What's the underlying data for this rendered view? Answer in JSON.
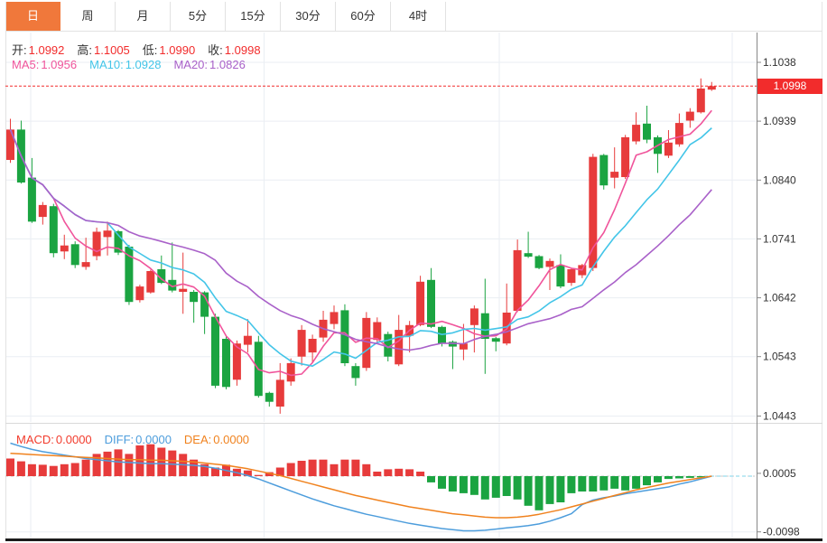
{
  "tabs": {
    "items": [
      {
        "label": "日",
        "active": true
      },
      {
        "label": "周",
        "active": false
      },
      {
        "label": "月",
        "active": false
      },
      {
        "label": "5分",
        "active": false
      },
      {
        "label": "15分",
        "active": false
      },
      {
        "label": "30分",
        "active": false
      },
      {
        "label": "60分",
        "active": false
      },
      {
        "label": "4时",
        "active": false
      }
    ]
  },
  "price_panel": {
    "ohlc_legend": {
      "open_label": "开:",
      "open": "1.0992",
      "high_label": "高:",
      "high": "1.1005",
      "low_label": "低:",
      "low": "1.0990",
      "close_label": "收:",
      "close": "1.0998"
    },
    "ma_legend": {
      "ma5_label": "MA5:",
      "ma5": "1.0956",
      "ma10_label": "MA10:",
      "ma10": "1.0928",
      "ma20_label": "MA20:",
      "ma20": "1.0826"
    },
    "last_price_badge": "1.0998",
    "axis_labels": [
      "1.1038",
      "1.0939",
      "1.0840",
      "1.0741",
      "1.0642",
      "1.0543",
      "1.0443"
    ]
  },
  "macd_panel": {
    "legend": {
      "macd_label": "MACD:",
      "macd": "0.0000",
      "diff_label": "DIFF:",
      "diff": "0.0000",
      "dea_label": "DEA:",
      "dea": "0.0000"
    },
    "axis_labels": [
      "0.0005",
      "-0.0098"
    ]
  },
  "chart_data": {
    "type": "candlestick+macd",
    "price": {
      "ohlc": [
        [
          1.0874,
          1.0943,
          1.0869,
          1.0925
        ],
        [
          1.0925,
          1.094,
          1.0834,
          1.0836
        ],
        [
          1.0844,
          1.0877,
          1.0768,
          1.077
        ],
        [
          1.0778,
          1.0803,
          1.0765,
          1.0798
        ],
        [
          1.0796,
          1.08,
          1.071,
          1.0717
        ],
        [
          1.072,
          1.0748,
          1.0707,
          1.073
        ],
        [
          1.0732,
          1.0737,
          1.0692,
          1.0697
        ],
        [
          1.0694,
          1.0743,
          1.0689,
          1.0702
        ],
        [
          1.0712,
          1.076,
          1.0705,
          1.0753
        ],
        [
          1.0744,
          1.077,
          1.0713,
          1.0755
        ],
        [
          1.0754,
          1.0756,
          1.0714,
          1.0718
        ],
        [
          1.0728,
          1.0731,
          1.063,
          1.0635
        ],
        [
          1.0638,
          1.0664,
          1.0634,
          1.0661
        ],
        [
          1.0651,
          1.0689,
          1.0649,
          1.0687
        ],
        [
          1.069,
          1.0713,
          1.0665,
          1.0667
        ],
        [
          1.0672,
          1.0735,
          1.0651,
          1.0654
        ],
        [
          1.0652,
          1.0718,
          1.0615,
          1.0657
        ],
        [
          1.0652,
          1.0655,
          1.06,
          1.0635
        ],
        [
          1.0651,
          1.0653,
          1.0581,
          1.061
        ],
        [
          1.061,
          1.0615,
          1.049,
          1.0494
        ],
        [
          1.0573,
          1.0578,
          1.0488,
          1.0492
        ],
        [
          1.0504,
          1.057,
          1.0494,
          1.0565
        ],
        [
          1.0563,
          1.0606,
          1.055,
          1.0578
        ],
        [
          1.0568,
          1.0578,
          1.0474,
          1.0477
        ],
        [
          1.0482,
          1.0484,
          1.0459,
          1.0467
        ],
        [
          1.0459,
          1.0532,
          1.0447,
          1.0504
        ],
        [
          1.0501,
          1.054,
          1.0494,
          1.0532
        ],
        [
          1.0543,
          1.0596,
          1.0528,
          1.0588
        ],
        [
          1.055,
          1.058,
          1.0532,
          1.0573
        ],
        [
          1.0575,
          1.062,
          1.0568,
          1.0605
        ],
        [
          1.0598,
          1.0629,
          1.0589,
          1.0618
        ],
        [
          1.0621,
          1.0631,
          1.0527,
          1.0532
        ],
        [
          1.0527,
          1.0532,
          1.0494,
          1.0507
        ],
        [
          1.0524,
          1.0618,
          1.0519,
          1.0608
        ],
        [
          1.0571,
          1.0609,
          1.0565,
          1.0601
        ],
        [
          1.0581,
          1.0585,
          1.0535,
          1.0543
        ],
        [
          1.053,
          1.0613,
          1.0527,
          1.0588
        ],
        [
          1.0578,
          1.0603,
          1.055,
          1.0596
        ],
        [
          1.0596,
          1.0679,
          1.0594,
          1.0669
        ],
        [
          1.0672,
          1.0692,
          1.0591,
          1.0593
        ],
        [
          1.0593,
          1.0595,
          1.056,
          1.0565
        ],
        [
          1.0568,
          1.057,
          1.0522,
          1.056
        ],
        [
          1.0555,
          1.0598,
          1.0537,
          1.0565
        ],
        [
          1.0596,
          1.0629,
          1.055,
          1.0624
        ],
        [
          1.0616,
          1.0674,
          1.0514,
          1.0573
        ],
        [
          1.0574,
          1.0576,
          1.0552,
          1.0568
        ],
        [
          1.0565,
          1.0666,
          1.0562,
          1.0617
        ],
        [
          1.062,
          1.074,
          1.0618,
          1.0722
        ],
        [
          1.0717,
          1.0753,
          1.0709,
          1.0711
        ],
        [
          1.0712,
          1.0714,
          1.069,
          1.0692
        ],
        [
          1.0694,
          1.0708,
          1.0655,
          1.0704
        ],
        [
          1.0697,
          1.0715,
          1.0658,
          1.0661
        ],
        [
          1.0667,
          1.0692,
          1.0662,
          1.069
        ],
        [
          1.068,
          1.0699,
          1.0675,
          1.0697
        ],
        [
          1.0692,
          1.0884,
          1.0687,
          1.0879
        ],
        [
          1.0882,
          1.0884,
          1.0824,
          1.0831
        ],
        [
          1.0844,
          1.0895,
          1.0826,
          1.0854
        ],
        [
          1.0845,
          1.0916,
          1.0842,
          1.0912
        ],
        [
          1.0905,
          1.0954,
          1.09,
          1.0933
        ],
        [
          1.0935,
          1.0965,
          1.0902,
          1.0908
        ],
        [
          1.0912,
          1.0915,
          1.0852,
          1.0884
        ],
        [
          1.0881,
          1.0924,
          1.0877,
          1.0903
        ],
        [
          1.09,
          1.0952,
          1.0896,
          1.0936
        ],
        [
          1.094,
          1.0961,
          1.0928,
          1.0955
        ],
        [
          1.0954,
          1.1011,
          1.0952,
          1.0994
        ],
        [
          1.0992,
          1.1005,
          1.099,
          1.0998
        ]
      ],
      "ma_periods": [
        5,
        10,
        20
      ],
      "ma_current": {
        "ma5": 1.0956,
        "ma10": 1.0928,
        "ma20": 1.0826
      },
      "gridlines": [
        1.1038,
        1.0939,
        1.084,
        1.0741,
        1.0642,
        1.0543,
        1.0443
      ],
      "axis_range": [
        1.0443,
        1.1038
      ],
      "last_close": 1.0998,
      "current": {
        "open": 1.0992,
        "high": 1.1005,
        "low": 1.099,
        "close": 1.0998
      }
    },
    "macd": {
      "hist": [
        0.0031,
        0.0026,
        0.0021,
        0.002,
        0.0018,
        0.0021,
        0.0023,
        0.0029,
        0.0039,
        0.0043,
        0.0047,
        0.0039,
        0.0054,
        0.0056,
        0.005,
        0.0045,
        0.0039,
        0.0029,
        0.0021,
        0.0015,
        0.002,
        0.0013,
        0.001,
        0.0002,
        0.0007,
        0.0015,
        0.0023,
        0.0027,
        0.0029,
        0.0029,
        0.0021,
        0.0029,
        0.0029,
        0.0021,
        0.0008,
        0.0012,
        0.0013,
        0.0012,
        0.0008,
        -0.0011,
        -0.0022,
        -0.0027,
        -0.003,
        -0.0033,
        -0.0041,
        -0.0038,
        -0.0035,
        -0.0041,
        -0.0052,
        -0.006,
        -0.0049,
        -0.0046,
        -0.003,
        -0.0027,
        -0.0027,
        -0.0025,
        -0.0022,
        -0.0025,
        -0.0022,
        -0.0016,
        -0.0011,
        -0.0005,
        -0.0004,
        -0.0003,
        -0.0002,
        0.0
      ],
      "diff": [
        0.0058,
        0.0052,
        0.0047,
        0.0043,
        0.004,
        0.0037,
        0.0034,
        0.0031,
        0.0029,
        0.0027,
        0.0025,
        0.0024,
        0.0023,
        0.0022,
        0.0022,
        0.0021,
        0.002,
        0.0019,
        0.0017,
        0.0014,
        0.001,
        0.0006,
        0.0001,
        -0.0005,
        -0.0012,
        -0.0019,
        -0.0026,
        -0.0033,
        -0.004,
        -0.0046,
        -0.0052,
        -0.0057,
        -0.0062,
        -0.0067,
        -0.0071,
        -0.0075,
        -0.0079,
        -0.0083,
        -0.0086,
        -0.0089,
        -0.0092,
        -0.0094,
        -0.0096,
        -0.0096,
        -0.0095,
        -0.0093,
        -0.0091,
        -0.0089,
        -0.0087,
        -0.0084,
        -0.0079,
        -0.0073,
        -0.0066,
        -0.005,
        -0.0042,
        -0.0038,
        -0.0035,
        -0.0031,
        -0.0028,
        -0.0025,
        -0.0022,
        -0.0019,
        -0.0014,
        -0.001,
        -0.0005,
        0.0
      ],
      "dea": [
        0.004,
        0.0039,
        0.0038,
        0.0037,
        0.0036,
        0.0035,
        0.0034,
        0.0033,
        0.0032,
        0.0031,
        0.003,
        0.0029,
        0.0029,
        0.0028,
        0.0028,
        0.0027,
        0.0026,
        0.0025,
        0.0023,
        0.0021,
        0.0019,
        0.0016,
        0.0013,
        0.0009,
        0.0005,
        0.0001,
        -0.0004,
        -0.0009,
        -0.0014,
        -0.0019,
        -0.0024,
        -0.0029,
        -0.0034,
        -0.0038,
        -0.0042,
        -0.0046,
        -0.005,
        -0.0054,
        -0.0057,
        -0.006,
        -0.0063,
        -0.0066,
        -0.0068,
        -0.007,
        -0.0072,
        -0.0073,
        -0.0073,
        -0.0072,
        -0.007,
        -0.0067,
        -0.0063,
        -0.0059,
        -0.0054,
        -0.0049,
        -0.0044,
        -0.0039,
        -0.0034,
        -0.0029,
        -0.0024,
        -0.002,
        -0.0016,
        -0.0012,
        -0.0009,
        -0.0006,
        -0.0003,
        0.0
      ],
      "gridlines": [
        0.0005,
        -0.0098
      ],
      "current": {
        "macd": 0.0,
        "diff": 0.0,
        "dea": 0.0
      }
    },
    "colors": {
      "up": "#e73b3b",
      "down": "#1ba441",
      "ma5": "#f0549b",
      "ma10": "#43c5e8",
      "ma20": "#a961c9",
      "diff": "#4d9ddc",
      "dea": "#f0821e",
      "grid": "#eaeef3",
      "axis": "#888888",
      "last_price_line": "#f22c2c",
      "badge": "#f22c2c",
      "active_tab": "#f0783b"
    },
    "layout_hints": {
      "legend_position": "top-left",
      "grid": true,
      "y_axis_side": "right"
    }
  }
}
